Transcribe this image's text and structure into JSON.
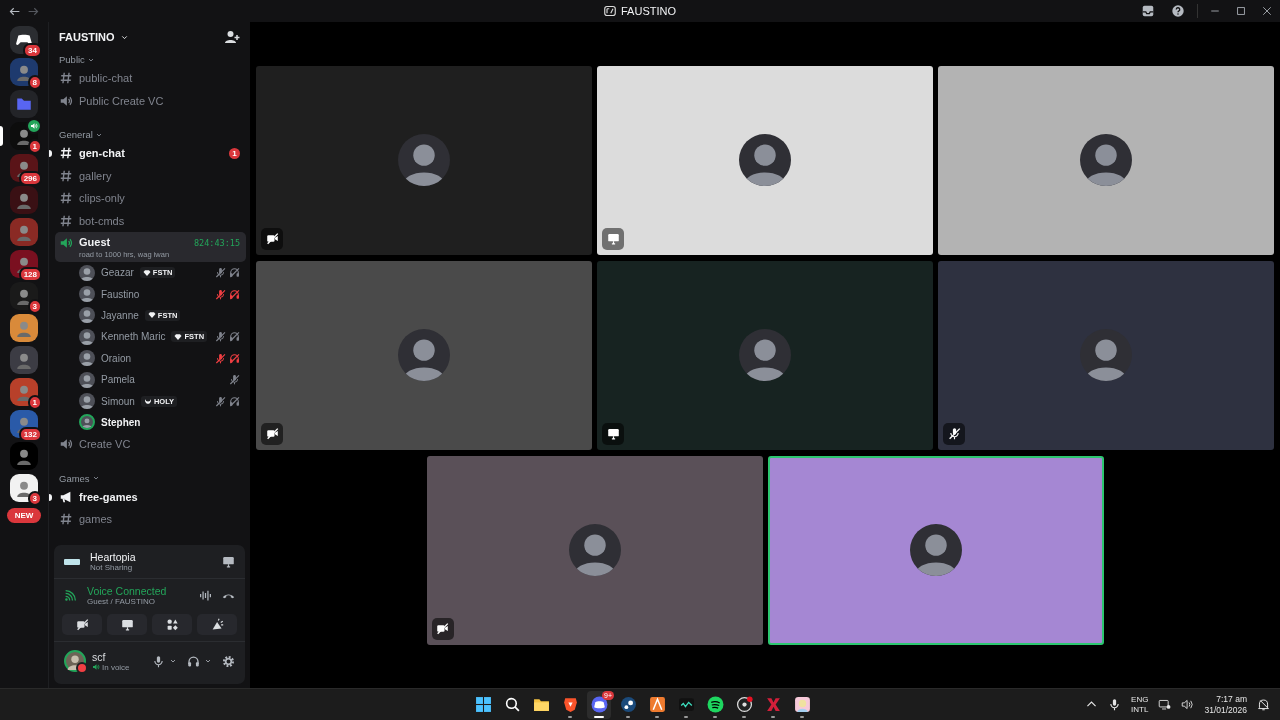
{
  "titlebar": {
    "title": "FAUSTINO"
  },
  "servers": [
    {
      "kind": "home",
      "badge": "34",
      "selected": false,
      "in_voice": false,
      "color": "#2b2d31"
    },
    {
      "kind": "picture",
      "badge": "8",
      "selected": false,
      "in_voice": false,
      "color": "#1e3a6e"
    },
    {
      "kind": "folder",
      "selected": false,
      "in_voice": false,
      "color": "#5865f2"
    },
    {
      "kind": "picture",
      "badge": "1",
      "selected": true,
      "in_voice": true,
      "color": "#0d0d0d"
    },
    {
      "kind": "picture",
      "badge": "296",
      "selected": false,
      "in_voice": false,
      "color": "#5a1418"
    },
    {
      "kind": "picture",
      "selected": false,
      "in_voice": false,
      "color": "#3a1014"
    },
    {
      "kind": "picture",
      "selected": false,
      "in_voice": false,
      "color": "#8a2a24"
    },
    {
      "kind": "picture",
      "badge": "128",
      "selected": false,
      "in_voice": false,
      "color": "#7a1020"
    },
    {
      "kind": "picture",
      "badge": "3",
      "selected": false,
      "in_voice": false,
      "color": "#1a1a1a"
    },
    {
      "kind": "picture",
      "selected": false,
      "in_voice": false,
      "color": "#d98a3a"
    },
    {
      "kind": "picture",
      "selected": false,
      "in_voice": false,
      "color": "#3c3c44"
    },
    {
      "kind": "picture",
      "badge": "1",
      "selected": false,
      "in_voice": false,
      "color": "#b8402a"
    },
    {
      "kind": "picture",
      "badge": "132",
      "selected": false,
      "in_voice": false,
      "color": "#2a5aa8"
    },
    {
      "kind": "picture",
      "selected": false,
      "in_voice": false,
      "color": "#000000"
    },
    {
      "kind": "picture",
      "badge": "3",
      "selected": false,
      "in_voice": false,
      "color": "#f2f2f2"
    }
  ],
  "new_button": "NEW",
  "server": {
    "name": "FAUSTINO"
  },
  "categories": [
    {
      "name": "Public",
      "channels": [
        {
          "kind": "text",
          "name": "public-chat",
          "selected": false,
          "unread": false
        },
        {
          "kind": "voice",
          "name": "Public Create VC",
          "selected": false,
          "unread": false
        }
      ]
    },
    {
      "name": "General",
      "channels": [
        {
          "kind": "text",
          "name": "gen-chat",
          "selected": false,
          "unread": true,
          "badge": "1"
        },
        {
          "kind": "text",
          "name": "gallery",
          "selected": false,
          "unread": false
        },
        {
          "kind": "text",
          "name": "clips-only",
          "selected": false,
          "unread": false
        },
        {
          "kind": "text",
          "name": "bot-cmds",
          "selected": false,
          "unread": false
        },
        {
          "kind": "voice",
          "name": "Guest",
          "selected": true,
          "unread": false,
          "status": "road to 1000 hrs, wag iwan",
          "timer": "824:43:15",
          "members": [
            {
              "name": "Geazar",
              "tag": {
                "kind": "gem",
                "text": "FSTN"
              },
              "muted": true,
              "deafened": true,
              "server_muted": false,
              "speaking": false
            },
            {
              "name": "Faustino",
              "muted": true,
              "deafened": true,
              "server_muted": true,
              "speaking": false
            },
            {
              "name": "Jayanne",
              "tag": {
                "kind": "gem",
                "text": "FSTN"
              },
              "muted": false,
              "deafened": false,
              "server_muted": false,
              "speaking": false
            },
            {
              "name": "Kenneth Maric",
              "tag": {
                "kind": "gem",
                "text": "FSTN"
              },
              "muted": true,
              "deafened": true,
              "server_muted": false,
              "speaking": false
            },
            {
              "name": "Oraion",
              "muted": true,
              "deafened": true,
              "server_muted": true,
              "speaking": false
            },
            {
              "name": "Pamela",
              "muted": true,
              "deafened": false,
              "server_muted": false,
              "speaking": false
            },
            {
              "name": "Simoun",
              "tag": {
                "kind": "moon",
                "text": "HOLY"
              },
              "muted": true,
              "deafened": true,
              "server_muted": false,
              "speaking": false
            },
            {
              "name": "Stephen",
              "muted": false,
              "deafened": false,
              "server_muted": false,
              "speaking": true
            }
          ]
        },
        {
          "kind": "voice",
          "name": "Create VC",
          "selected": false,
          "unread": false
        }
      ]
    },
    {
      "name": "Games",
      "channels": [
        {
          "kind": "announcement",
          "name": "free-games",
          "selected": false,
          "unread": true
        },
        {
          "kind": "text",
          "name": "games",
          "selected": false,
          "unread": false
        }
      ]
    }
  ],
  "activity": {
    "game": "Heartopia",
    "status": "Not Sharing"
  },
  "voice": {
    "status": "Voice Connected",
    "location": "Guest / FAUSTINO"
  },
  "controls": [
    {
      "kind": "camera-off"
    },
    {
      "kind": "screen-share"
    },
    {
      "kind": "activities"
    },
    {
      "kind": "soundboard"
    }
  ],
  "user": {
    "name": "scf",
    "status": "In voice"
  },
  "tiles": [
    {
      "color": "#1f1f1f",
      "video_off": true,
      "streaming": false,
      "muted": false,
      "speaking": false
    },
    {
      "color": "#dcdcdc",
      "video_off": false,
      "streaming": true,
      "muted": false,
      "speaking": false
    },
    {
      "color": "#b3b3b3",
      "video_off": false,
      "streaming": false,
      "muted": false,
      "speaking": false
    },
    {
      "color": "#4a4a4a",
      "video_off": true,
      "streaming": false,
      "muted": false,
      "speaking": false
    },
    {
      "color": "#172321",
      "video_off": false,
      "streaming": true,
      "muted": false,
      "speaking": false
    },
    {
      "color": "#2e3140",
      "video_off": false,
      "streaming": false,
      "muted": true,
      "speaking": false
    },
    {
      "color": "#5a5058",
      "video_off": true,
      "streaming": false,
      "muted": false,
      "speaking": false
    },
    {
      "color": "#a587d3",
      "video_off": false,
      "streaming": false,
      "muted": false,
      "speaking": true
    }
  ],
  "taskbar": {
    "apps": [
      {
        "kind": "start",
        "running": false,
        "active": false
      },
      {
        "kind": "search",
        "running": false,
        "active": false
      },
      {
        "kind": "files",
        "running": false,
        "active": false
      },
      {
        "kind": "browser",
        "running": true,
        "active": false
      },
      {
        "kind": "discord",
        "running": true,
        "active": true,
        "badge": "9+"
      },
      {
        "kind": "steam",
        "running": true,
        "active": false
      },
      {
        "kind": "launcher",
        "running": true,
        "active": false
      },
      {
        "kind": "terminal",
        "running": true,
        "active": false
      },
      {
        "kind": "spotify",
        "running": true,
        "active": false
      },
      {
        "kind": "recorder",
        "running": true,
        "active": false
      },
      {
        "kind": "x-app",
        "running": true,
        "active": false
      },
      {
        "kind": "game",
        "running": true,
        "active": false
      }
    ],
    "language": "ENG",
    "layout": "INTL",
    "time": "7:17 am",
    "date": "31/01/2026"
  }
}
